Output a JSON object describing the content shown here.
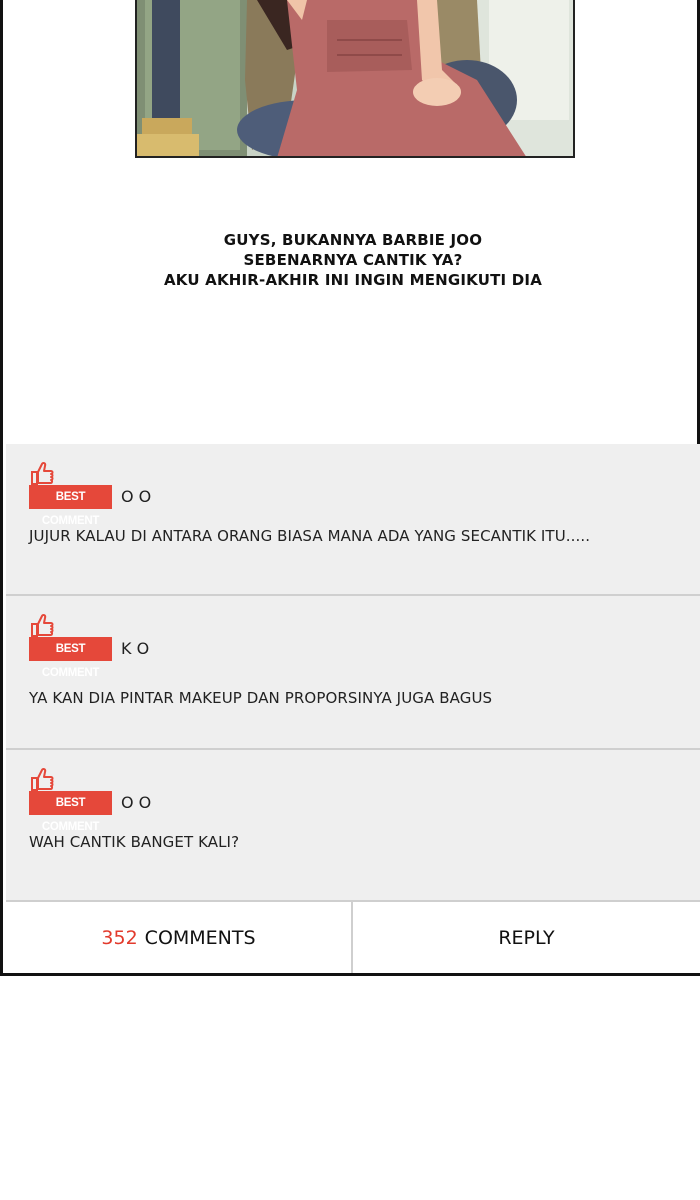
{
  "post": {
    "caption_lines": [
      "GUYS, BUKANNYA BARBIE JOO",
      "SEBENARNYA CANTIK YA?",
      "AKU AKHIR-AKHIR INI INGIN MENGIKUTI DIA"
    ]
  },
  "comments": [
    {
      "badge": "BEST COMMENT",
      "author": "O O",
      "text": "JUJUR KALAU DI ANTARA ORANG BIASA MANA ADA YANG SECANTIK ITU....."
    },
    {
      "badge": "BEST COMMENT",
      "author": "K O",
      "text": "YA KAN DIA PINTAR MAKEUP DAN PROPORSINYA JUGA BAGUS"
    },
    {
      "badge": "BEST COMMENT",
      "author": "O O",
      "text": "WAH CANTIK BANGET KALI?"
    }
  ],
  "footer": {
    "comment_count": "352",
    "comments_label": "COMMENTS",
    "reply_label": "REPLY"
  },
  "icons": {
    "like": "thumbs-up-icon"
  },
  "colors": {
    "accent": "#e5483a",
    "count": "#e23a2c",
    "comment_bg": "#efefef"
  }
}
